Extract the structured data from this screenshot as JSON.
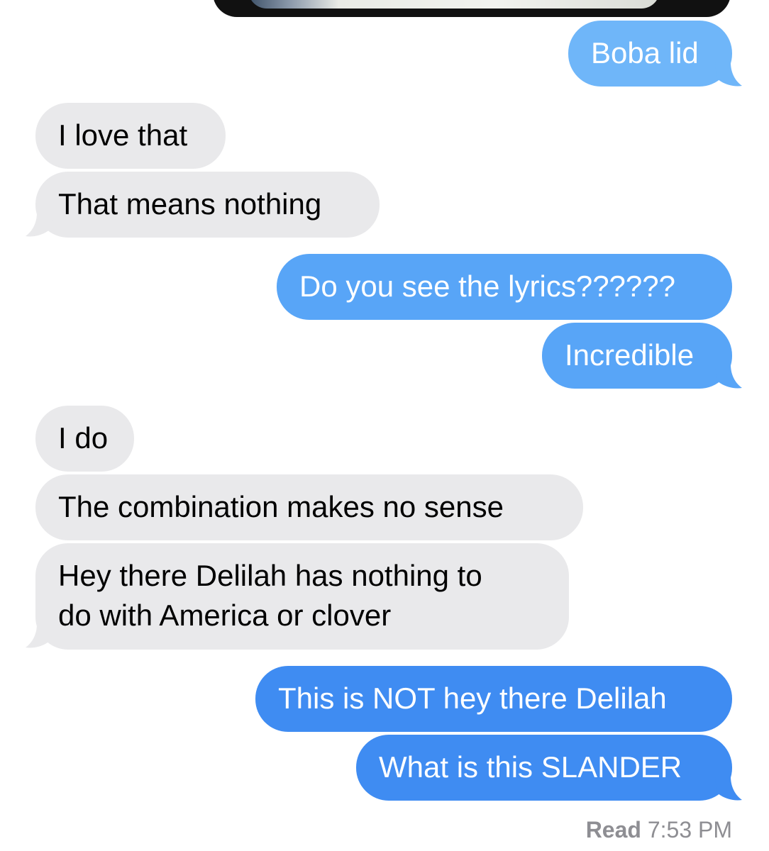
{
  "conversation": {
    "messages": [
      {
        "direction": "sent",
        "text": "Boba lid"
      },
      {
        "direction": "received",
        "text": "I love that"
      },
      {
        "direction": "received",
        "text": "That means nothing"
      },
      {
        "direction": "sent",
        "text": "Do you see the lyrics??????"
      },
      {
        "direction": "sent",
        "text": "Incredible"
      },
      {
        "direction": "received",
        "text": "I do"
      },
      {
        "direction": "received",
        "text": "The combination makes no sense"
      },
      {
        "direction": "received",
        "text_lines": [
          "Hey there Delilah has nothing to",
          "do with America or clover"
        ]
      },
      {
        "direction": "sent",
        "text": "This is NOT hey there Delilah"
      },
      {
        "direction": "sent",
        "text": "What is this SLANDER"
      }
    ],
    "read_receipt": {
      "status": "Read",
      "time": "7:53 PM"
    }
  },
  "colors": {
    "sent_bubble": "#4a96f6",
    "received_bubble": "#e9e9eb",
    "receipt_text": "#8e8e93"
  }
}
